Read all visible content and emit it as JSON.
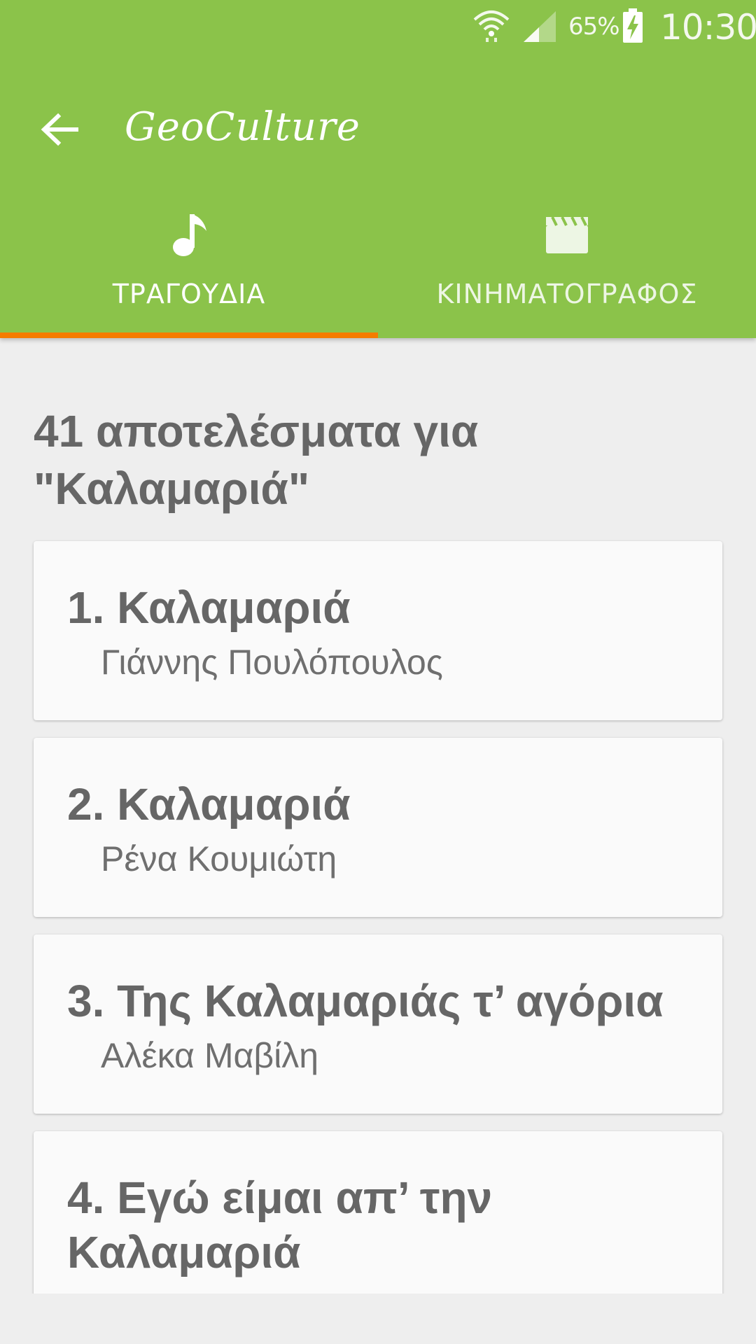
{
  "status_bar": {
    "battery_percent": "65%",
    "time": "10:30",
    "icons": [
      "wifi-icon",
      "signal-icon",
      "battery-charging-icon"
    ]
  },
  "toolbar": {
    "back_icon": "arrow-back-icon",
    "title": "GeoCulture"
  },
  "tabs": [
    {
      "label": "ΤΡΑΓΟΥΔΙΑ",
      "icon": "music-note-icon",
      "selected": true
    },
    {
      "label": "ΚΙΝΗΜΑΤΟΓΡΑΦΟΣ",
      "icon": "clapperboard-icon",
      "selected": false
    }
  ],
  "results": {
    "heading": "41 αποτελέσματα για \"Καλαμαριά\"",
    "items": [
      {
        "title": "1. Καλαμαριά",
        "artist": "Γιάννης Πουλόπουλος"
      },
      {
        "title": "2. Καλαμαριά",
        "artist": "Ρένα Κουμιώτη"
      },
      {
        "title": "3. Της Καλαμαριάς τ’ αγόρια",
        "artist": "Αλέκα Μαβίλη"
      },
      {
        "title": "4. Εγώ είμαι απ’ την Καλαμαριά",
        "artist": ""
      }
    ]
  },
  "colors": {
    "primary": "#8bc34a",
    "tab_indicator": "#f57c00",
    "background": "#eeeeee",
    "card": "#fafafa",
    "text": "#666666"
  }
}
